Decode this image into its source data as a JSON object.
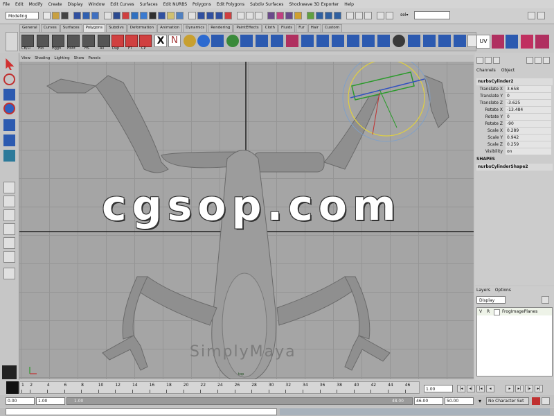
{
  "menubar": [
    "File",
    "Edit",
    "Modify",
    "Create",
    "Display",
    "Window",
    "Edit Curves",
    "Surfaces",
    "Edit NURBS",
    "Polygons",
    "Edit Polygons",
    "Subdiv Surfaces",
    "Shockwave 3D Exporter",
    "Help"
  ],
  "status": {
    "mode": "Modeling",
    "sel_label": "sel▾"
  },
  "shelf": {
    "tabs": [
      "General",
      "Curves",
      "Surfaces",
      "Polygons",
      "Subdivs",
      "Deformation",
      "Animation",
      "Dynamics",
      "Rendering",
      "PaintEffects",
      "Cloth",
      "Fluids",
      "Fur",
      "Hair",
      "Custom"
    ],
    "active_tab": "Polygons",
    "labels": [
      "CB/LI",
      "Hio",
      "Hggh",
      "Hoht",
      "HS",
      "All",
      "Dup",
      "FT",
      "CP",
      "X",
      "N",
      "UV"
    ]
  },
  "panel_menu": [
    "View",
    "Shading",
    "Lighting",
    "Show",
    "Panels"
  ],
  "viewport": {
    "camera_label": "top",
    "watermark": "cgsop.com",
    "logo": "SimplyMaya"
  },
  "channel_box": {
    "tabs": [
      "Channels",
      "Object"
    ],
    "object": "nurbsCylinder2",
    "attributes": [
      {
        "name": "Translate X",
        "value": "3.658"
      },
      {
        "name": "Translate Y",
        "value": "0"
      },
      {
        "name": "Translate Z",
        "value": "-3.625"
      },
      {
        "name": "Rotate X",
        "value": "-13.484"
      },
      {
        "name": "Rotate Y",
        "value": "0"
      },
      {
        "name": "Rotate Z",
        "value": "-90"
      },
      {
        "name": "Scale X",
        "value": "0.289"
      },
      {
        "name": "Scale Y",
        "value": "0.942"
      },
      {
        "name": "Scale Z",
        "value": "0.259"
      },
      {
        "name": "Visibility",
        "value": "on"
      }
    ],
    "shapes_header": "SHAPES",
    "shape_name": "nurbsCylinderShape2"
  },
  "layers": {
    "menu": [
      "Layers",
      "Options"
    ],
    "display_select": "Display",
    "layer_v": "V",
    "layer_r": "R",
    "layer_name": "FrogImagePlanes"
  },
  "timeline": {
    "ticks": [
      "1",
      "2",
      "4",
      "6",
      "8",
      "10",
      "12",
      "14",
      "16",
      "18",
      "20",
      "22",
      "24",
      "26",
      "28",
      "30",
      "32",
      "34",
      "36",
      "38",
      "40",
      "42",
      "44",
      "46"
    ],
    "current_time": "1.00"
  },
  "range": {
    "start_time": "0.00",
    "start_playback": "1.00",
    "bar_start": "1.00",
    "bar_end": "48.00",
    "end_playback": "46.00",
    "end_time": "50.00",
    "character_set": "No Character Set"
  },
  "colors": {
    "viewport_bg": "#a5a5a5",
    "grid": "#959595",
    "manip_green": "#2a9a2a",
    "manip_blue": "#3050c0",
    "manip_yellow": "#e0d040"
  }
}
